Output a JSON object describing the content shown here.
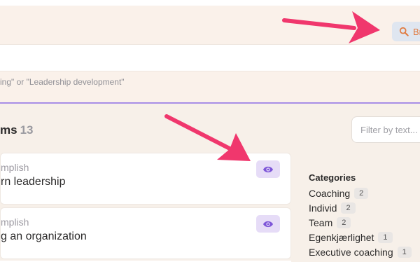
{
  "header": {
    "browse_button": {
      "label": "Br",
      "icon": "search-icon",
      "color": "#e07a3f"
    }
  },
  "search": {
    "hint": "ing\" or \"Leadership development\""
  },
  "items": {
    "heading": "ms",
    "count": "13",
    "filter_placeholder": "Filter by text..."
  },
  "cards": [
    {
      "subtitle": "mplish",
      "title": "rn leadership",
      "action_icon": "eye-icon"
    },
    {
      "subtitle": "mplish",
      "title": "g an organization",
      "action_icon": "eye-icon"
    }
  ],
  "categories": {
    "title": "Categories",
    "list": [
      {
        "label": "Coaching",
        "count": "2"
      },
      {
        "label": "Individ",
        "count": "2"
      },
      {
        "label": "Team",
        "count": "2"
      },
      {
        "label": "Egenkjærlighet",
        "count": "1"
      },
      {
        "label": "Executive coaching",
        "count": "1"
      }
    ]
  },
  "colors": {
    "accent_purple": "#a88ee6",
    "annotation_arrow": "#f0376d"
  }
}
